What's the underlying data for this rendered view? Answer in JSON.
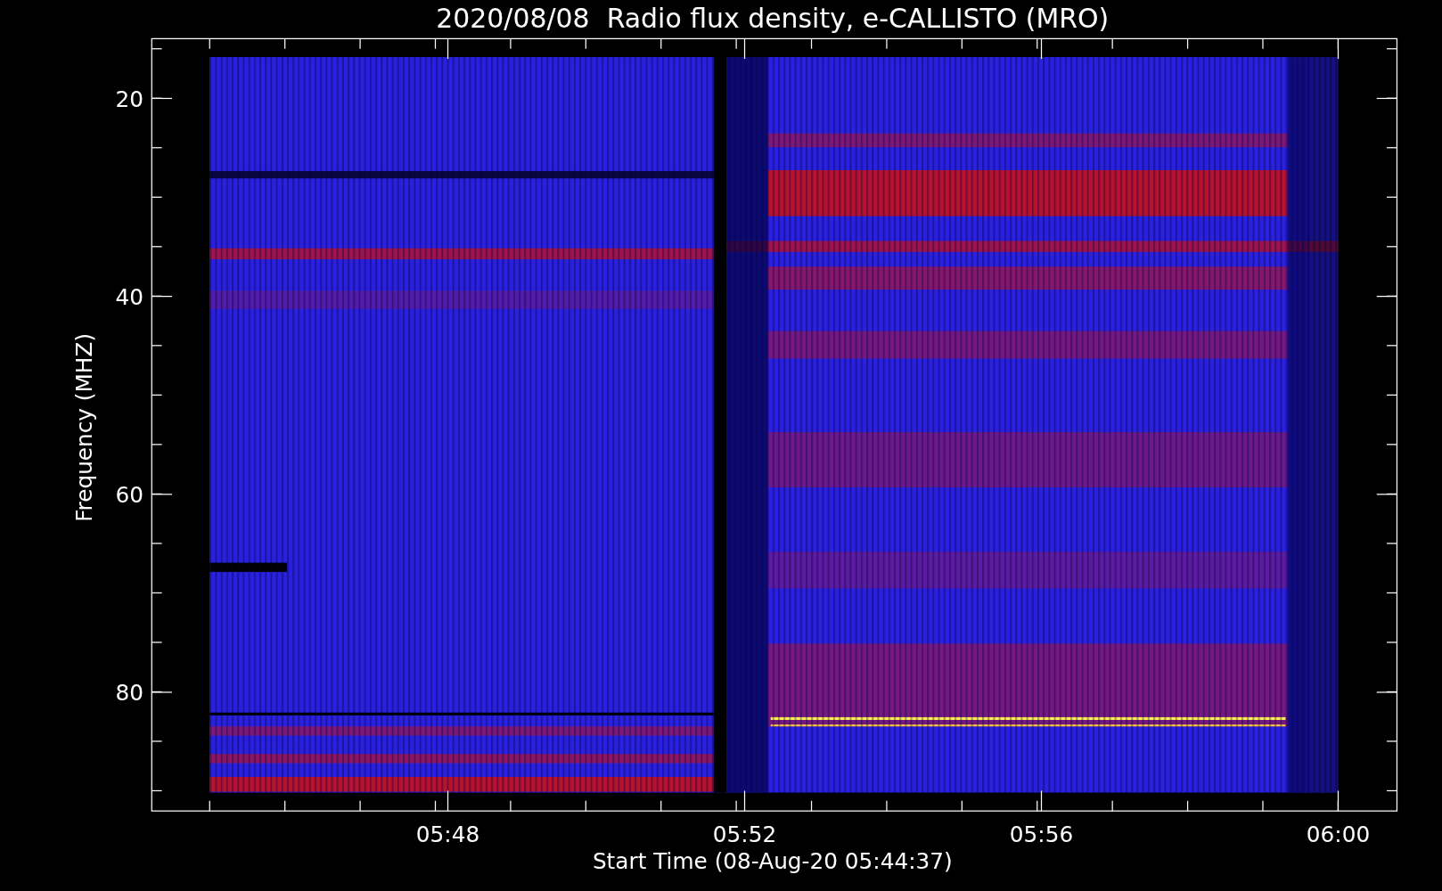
{
  "plot": {
    "title": "2020/08/08  Radio flux density, e-CALLISTO (MRO)",
    "ylabel": "Frequency (MHZ)",
    "xlabel": "Start Time (08-Aug-20 05:44:37)",
    "yticks": [
      "20",
      "40",
      "60",
      "80"
    ],
    "xticks": [
      "05:48",
      "05:52",
      "05:56",
      "06:00"
    ]
  }
}
